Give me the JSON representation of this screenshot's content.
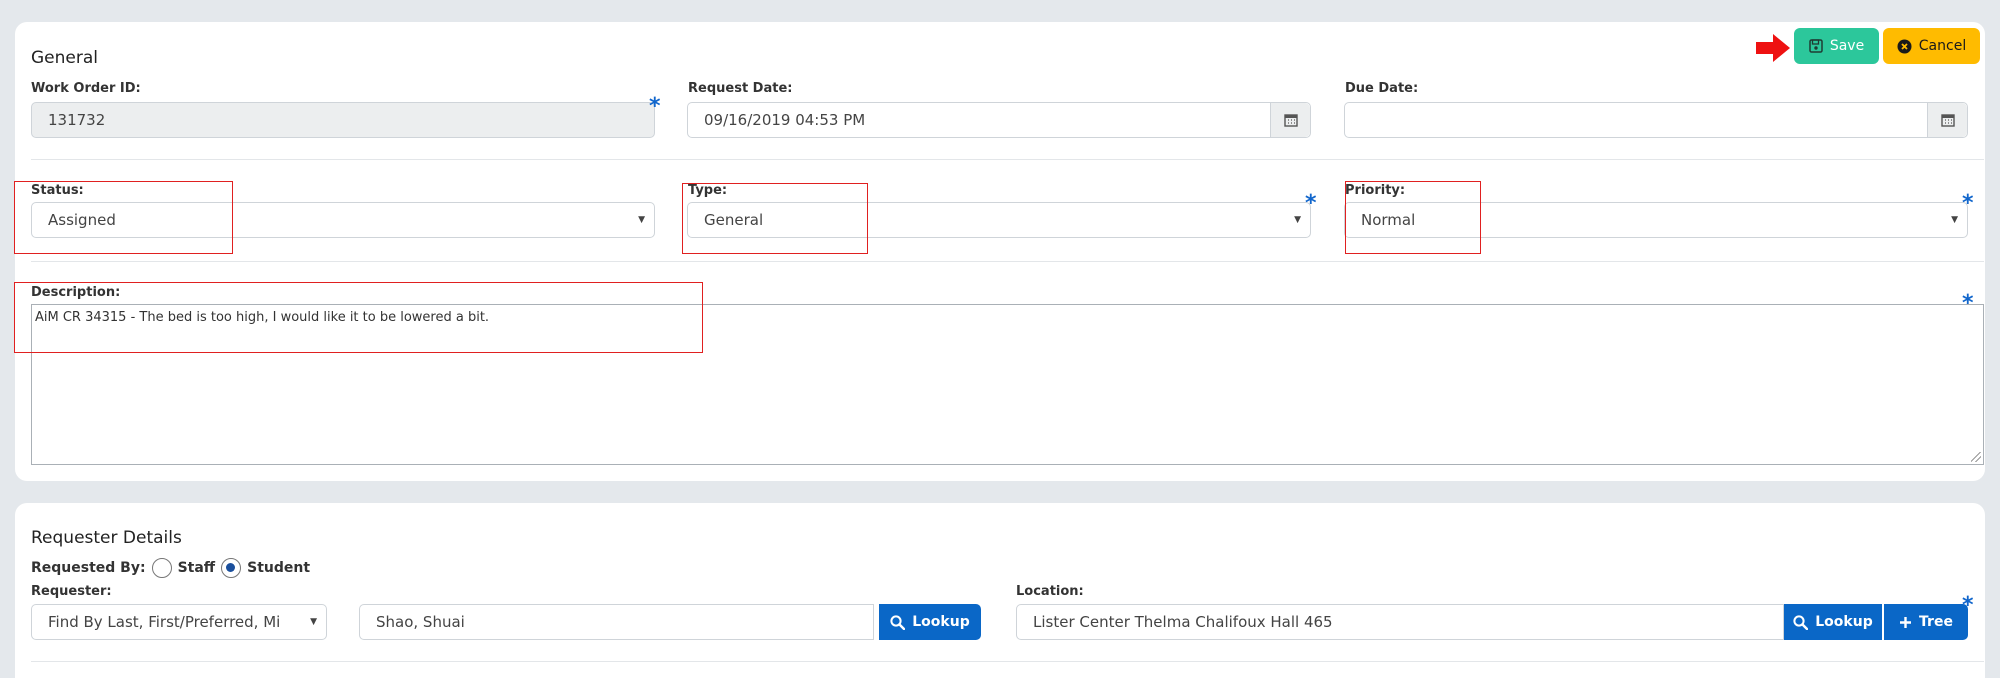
{
  "general": {
    "title": "General",
    "save_label": "Save",
    "cancel_label": "Cancel",
    "work_order_id": {
      "label": "Work Order ID:",
      "value": "131732"
    },
    "request_date": {
      "label": "Request Date:",
      "value": "09/16/2019 04:53 PM"
    },
    "due_date": {
      "label": "Due Date:",
      "value": ""
    },
    "status": {
      "label": "Status:",
      "value": "Assigned"
    },
    "type": {
      "label": "Type:",
      "value": "General"
    },
    "priority": {
      "label": "Priority:",
      "value": "Normal"
    },
    "description": {
      "label": "Description:",
      "value": "AiM CR 34315 - The bed is too high, I would like it to be lowered a bit."
    },
    "required_marker": "*"
  },
  "requester": {
    "title": "Requester Details",
    "requested_by_label": "Requested By:",
    "options": [
      "Staff",
      "Student"
    ],
    "selected_option": "Student",
    "requester_label": "Requester:",
    "find_by_value": "Find By Last, First/Preferred, Mi",
    "requester_value": "Shao, Shuai",
    "lookup_label": "Lookup",
    "location_label": "Location:",
    "location_value": "Lister Center Thelma Chalifoux Hall 465",
    "tree_label": "Tree"
  },
  "colors": {
    "save": "#2cc79b",
    "cancel": "#ffbb00",
    "primary": "#0a67c7",
    "highlight": "#e02020",
    "required": "#1166cc"
  }
}
